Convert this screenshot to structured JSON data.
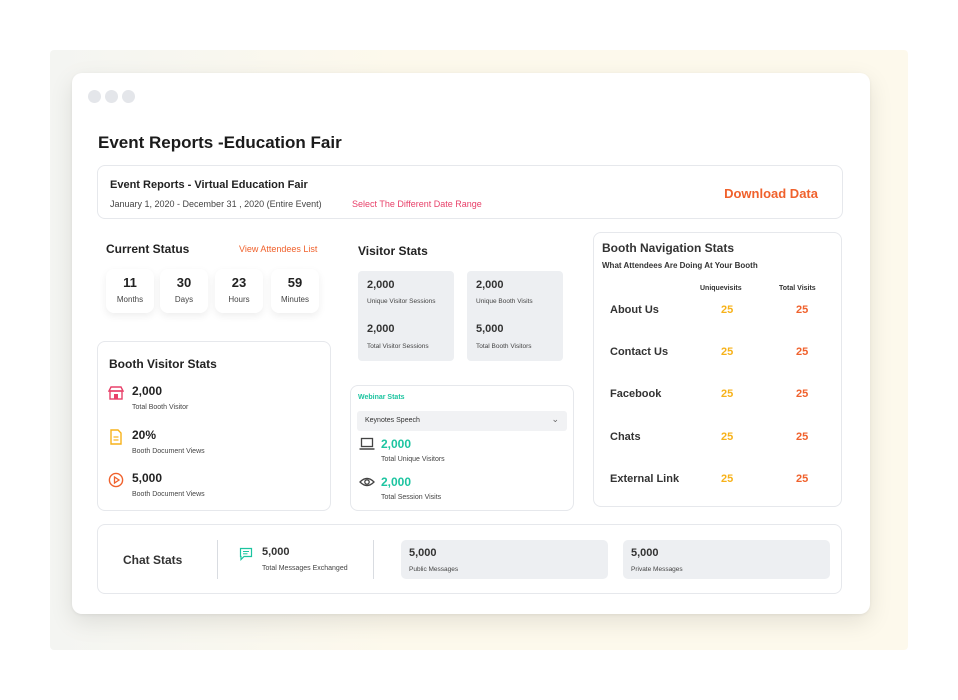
{
  "page_title": "Event Reports -Education Fair",
  "date_bar": {
    "event_name": "Event Reports - Virtual Education Fair",
    "date_range": "January 1, 2020 - December 31 , 2020 (Entire Event)",
    "select_range_link": "Select The Different Date Range",
    "download_button": "Download Data"
  },
  "current_status": {
    "title": "Current Status",
    "attendees_link": "View Attendees List",
    "countdown": [
      {
        "value": "11",
        "unit": "Months"
      },
      {
        "value": "30",
        "unit": "Days"
      },
      {
        "value": "23",
        "unit": "Hours"
      },
      {
        "value": "59",
        "unit": "Minutes"
      }
    ]
  },
  "visitor_stats": {
    "title": "Visitor Stats",
    "boxes": [
      {
        "value1": "2,000",
        "label1": "Unique Visitor Sessions",
        "value2": "2,000",
        "label2": "Total Visitor Sessions"
      },
      {
        "value1": "2,000",
        "label1": "Unique Booth Visits",
        "value2": "5,000",
        "label2": "Total Booth Visitors"
      }
    ]
  },
  "booth_visitor_stats": {
    "title": "Booth Visitor Stats",
    "rows": [
      {
        "icon": "booth-icon",
        "value": "2,000",
        "label": "Total Booth Visitor"
      },
      {
        "icon": "document-icon",
        "value": "20%",
        "label": "Booth Document Views"
      },
      {
        "icon": "play-icon",
        "value": "5,000",
        "label": "Booth Document Views"
      }
    ]
  },
  "webinar_stats": {
    "title": "Webinar Stats",
    "selected": "Keynotes Speech",
    "rows": [
      {
        "icon": "laptop-icon",
        "value": "2,000",
        "label": "Total Unique Visitors"
      },
      {
        "icon": "eye-icon",
        "value": "2,000",
        "label": "Total Session Visits"
      }
    ]
  },
  "booth_navigation": {
    "title": "Booth Navigation Stats",
    "subtitle": "What Attendees Are Doing At Your Booth",
    "col_unique": "Uniquevisits",
    "col_total": "Total Visits",
    "rows": [
      {
        "name": "About Us",
        "unique": "25",
        "total": "25"
      },
      {
        "name": "Contact Us",
        "unique": "25",
        "total": "25"
      },
      {
        "name": "Facebook",
        "unique": "25",
        "total": "25"
      },
      {
        "name": "Chats",
        "unique": "25",
        "total": "25"
      },
      {
        "name": "External Link",
        "unique": "25",
        "total": "25"
      }
    ]
  },
  "chat_stats": {
    "title": "Chat Stats",
    "messages_value": "5,000",
    "messages_label": "Total Messages Exchanged",
    "public_value": "5,000",
    "public_label": "Public Messages",
    "private_value": "5,000",
    "private_label": "Private Messages"
  },
  "colors": {
    "accent_orange": "#f0612c",
    "accent_yellow": "#f7b21a",
    "accent_teal": "#1cc4a0",
    "link_pink": "#e8416a"
  }
}
